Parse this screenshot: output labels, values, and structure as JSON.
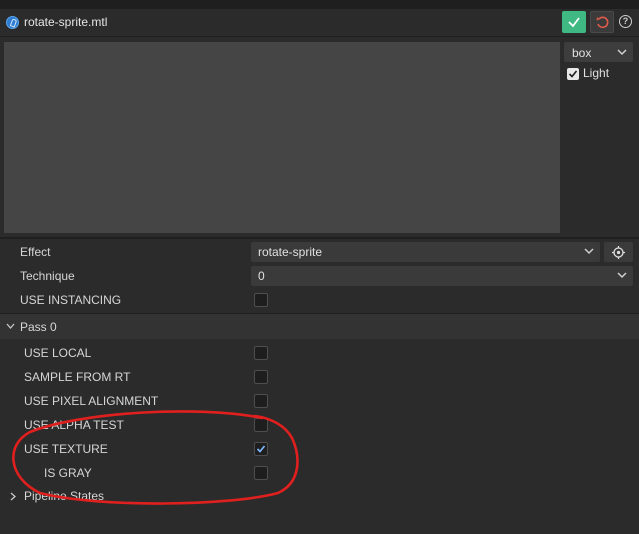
{
  "title": {
    "filename": "rotate-sprite.mtl"
  },
  "icons": {
    "file": "cocos-file-icon",
    "save": "check-icon",
    "reset": "undo-icon",
    "help": "question-icon",
    "locate": "locate-icon",
    "dropdown": "chevron-down-icon",
    "collapse": "chevron-right-icon",
    "expand": "chevron-down-icon"
  },
  "help_label": "?",
  "colors": {
    "accent": "#3fb883",
    "reset": "#e05a4a",
    "annotation": "#e0201e"
  },
  "preview": {
    "shape_value": "box",
    "light_label": "Light",
    "light_checked": true
  },
  "properties": {
    "effect": {
      "label": "Effect",
      "value": "rotate-sprite"
    },
    "technique": {
      "label": "Technique",
      "value": "0"
    },
    "use_instancing": {
      "label": "USE INSTANCING",
      "checked": false
    }
  },
  "pass": {
    "label": "Pass 0",
    "items": [
      {
        "label": "USE LOCAL",
        "checked": false
      },
      {
        "label": "SAMPLE FROM RT",
        "checked": false
      },
      {
        "label": "USE PIXEL ALIGNMENT",
        "checked": false
      },
      {
        "label": "USE ALPHA TEST",
        "checked": false
      },
      {
        "label": "USE TEXTURE",
        "checked": true
      },
      {
        "label": "IS GRAY",
        "checked": false
      }
    ]
  },
  "pipeline_states": {
    "label": "Pipeline States"
  }
}
